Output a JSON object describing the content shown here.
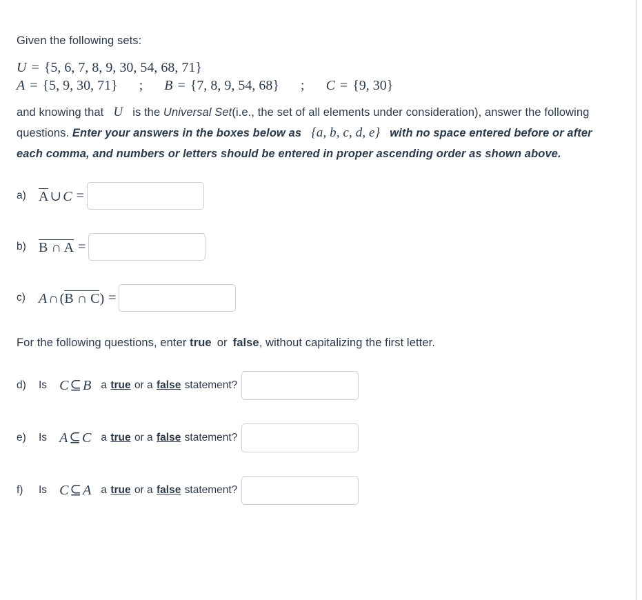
{
  "intro": {
    "lead": "Given the following sets:",
    "universe": {
      "name": "U",
      "eq": "=",
      "open": "{",
      "elements": "5, 6, 7, 8, 9, 30, 54, 68, 71",
      "close": "}"
    },
    "sets": [
      {
        "name": "A",
        "eq": "=",
        "open": "{",
        "elements": "5, 9, 30, 71",
        "close": "}"
      },
      {
        "name": "B",
        "eq": "=",
        "open": "{",
        "elements": "7, 8, 9, 54, 68",
        "close": "}"
      },
      {
        "name": "C",
        "eq": "=",
        "open": "{",
        "elements": "9, 30",
        "close": "}"
      }
    ],
    "separator": ";"
  },
  "instructions": {
    "part1": "and knowing that",
    "universal_symbol": "U",
    "part2": "is the",
    "universal_set_phrase": "Universal Set",
    "part3": "(i.e., the set of all elements under consideration), answer the following questions.",
    "bold_part1": "Enter your answers in the boxes below as",
    "format_example": "{a, b, c, d, e}",
    "bold_part2": "with no space entered before or after each comma, and numbers or letters should be entered in proper ascending order as shown above."
  },
  "questions": [
    {
      "label": "a)",
      "expr": {
        "overlined": "A",
        "operator": "∪",
        "rest": "C",
        "rest_italic": true
      },
      "equals": "=",
      "answer_value": "",
      "answer_placeholder": ""
    },
    {
      "label": "b)",
      "expr": {
        "overline_group": "B ∩ A"
      },
      "equals": "=",
      "answer_value": "",
      "answer_placeholder": ""
    },
    {
      "label": "c)",
      "expr": {
        "lead_var": "A",
        "operator": "∩",
        "paren_open": "(",
        "overline_group": "B ∩ C",
        "paren_close": ")"
      },
      "equals": "=",
      "answer_value": "",
      "answer_placeholder": ""
    }
  ],
  "tf_note": {
    "part1": "For the following questions, enter",
    "true_word": "true",
    "middle": "or",
    "false_word": "false",
    "part2": ", without capitalizing the first letter."
  },
  "tf_questions": [
    {
      "label": "d)",
      "is_word": "Is",
      "left": "C",
      "relation": "⊆",
      "right": "B",
      "a1": "a",
      "true_word": "true",
      "or_word": "or",
      "a2": "a",
      "false_word": "false",
      "statement_word": "statement?",
      "answer_value": "",
      "answer_placeholder": ""
    },
    {
      "label": "e)",
      "is_word": "Is",
      "left": "A",
      "relation": "⊆",
      "right": "C",
      "a1": "a",
      "true_word": "true",
      "or_word": "or",
      "a2": "a",
      "false_word": "false",
      "statement_word": "statement?",
      "answer_value": "",
      "answer_placeholder": ""
    },
    {
      "label": "f)",
      "is_word": "Is",
      "left": "C",
      "relation": "⊆",
      "right": "A",
      "a1": "a",
      "true_word": "true",
      "or_word": "or",
      "a2": "a",
      "false_word": "false",
      "statement_word": "statement?",
      "answer_value": "",
      "answer_placeholder": ""
    }
  ],
  "colors": {
    "text": "#2b3a4a",
    "border": "#cfcfcf",
    "page_border": "#c8c8c8",
    "background": "#ffffff"
  }
}
